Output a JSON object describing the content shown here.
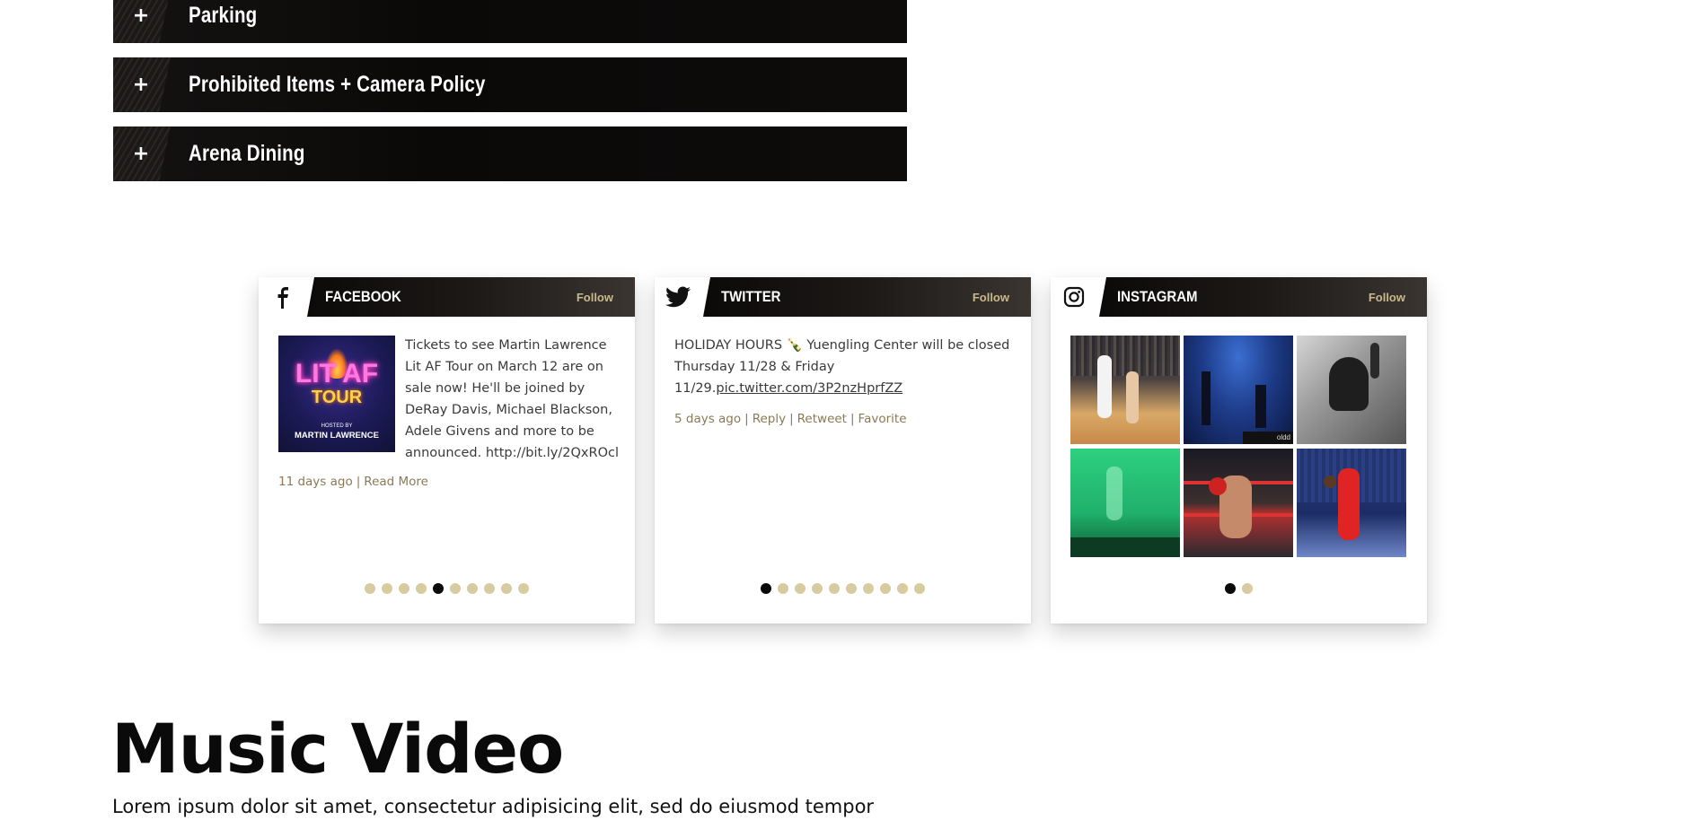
{
  "accordion": {
    "items": [
      {
        "label": "Parking"
      },
      {
        "label": "Prohibited Items + Camera Policy"
      },
      {
        "label": "Arena Dining"
      }
    ],
    "expand_glyph": "+"
  },
  "social": {
    "facebook": {
      "name": "FACEBOOK",
      "icon": "facebook-icon",
      "follow": "Follow",
      "post_text": "Tickets to see Martin Lawrence Lit AF Tour on March 12 are on sale now! He'll be joined by DeRay Davis, Michael Blackson, Adele Givens and more to be announced. http://bit.ly/2QxROcl",
      "image_title": "LIT AF",
      "image_subtitle": "TOUR",
      "image_hosted_by": "HOSTED BY",
      "image_host": "MARTIN LAWRENCE",
      "age": "11 days ago",
      "sep": "|",
      "read_more": "Read More",
      "dots_count": 10,
      "active_dot": 4
    },
    "twitter": {
      "name": "TWITTER",
      "icon": "twitter-icon",
      "follow": "Follow",
      "post_text_a": "HOLIDAY HOURS",
      "emoji": "🍾",
      "post_text_b": "Yuengling Center will be closed Thursday 11/28 & Friday 11/29.",
      "post_link": "pic.twitter.com/3P2nzHprfZZ",
      "age": "5 days ago",
      "sep": "|",
      "reply": "Reply",
      "retweet": "Retweet",
      "favorite": "Favorite",
      "dots_count": 10,
      "active_dot": 0
    },
    "instagram": {
      "name": "INSTAGRAM",
      "icon": "instagram-icon",
      "follow": "Follow",
      "tile_badge": "oldd",
      "dots_count": 2,
      "active_dot": 0
    }
  },
  "section": {
    "title": "Music Video",
    "body": "Lorem ipsum dolor sit amet, consectetur adipisicing elit, sed do eiusmod tempor"
  },
  "colors": {
    "accent_gold": "#c9b98a",
    "dot_inactive": "#d6cc9f",
    "dot_active": "#0a0a0a",
    "bar_black": "#0b0908"
  }
}
